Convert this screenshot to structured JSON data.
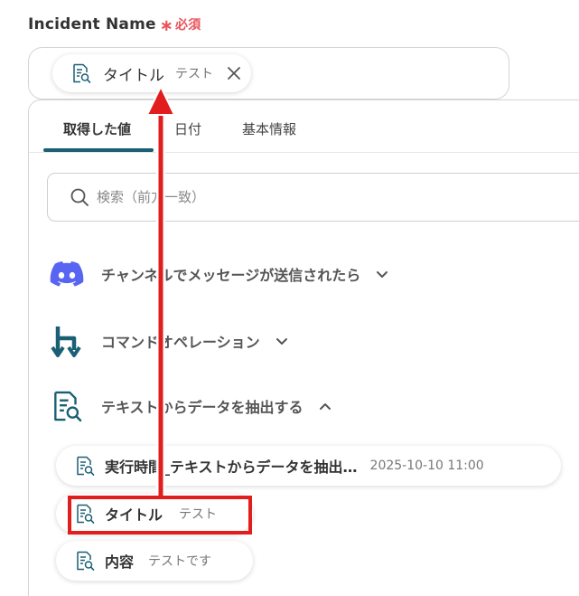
{
  "field": {
    "label": "Incident Name",
    "required_mark": "∗",
    "required_text": "必須",
    "chip": {
      "label": "タイトル",
      "value": "テスト"
    }
  },
  "panel": {
    "tabs": [
      {
        "label": "取得した値",
        "active": true
      },
      {
        "label": "日付",
        "active": false
      },
      {
        "label": "基本情報",
        "active": false
      }
    ],
    "search": {
      "placeholder": "検索（前方一致）"
    },
    "sections": [
      {
        "label": "チャンネルでメッセージが送信されたら",
        "icon": "discord-icon",
        "expanded": false
      },
      {
        "label": "コマンドオペレーション",
        "icon": "command-operation-icon",
        "expanded": false
      },
      {
        "label": "テキストからデータを抽出する",
        "icon": "document-search-icon",
        "expanded": true
      }
    ],
    "items": [
      {
        "label": "実行時間_テキストからデータを抽出…",
        "value": "2025-10-10 11:00"
      },
      {
        "label": "タイトル",
        "value": "テスト"
      },
      {
        "label": "内容",
        "value": "テストです"
      }
    ]
  },
  "colors": {
    "accent": "#1a5f73",
    "required": "#e8545a",
    "discord": "#5865f2",
    "annotation": "#e11d1d"
  }
}
